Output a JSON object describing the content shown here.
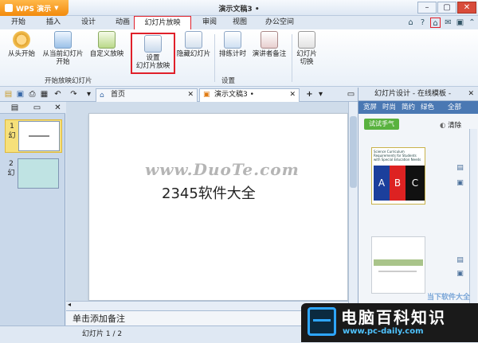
{
  "app": {
    "name": "WPS 演示",
    "doc_title": "演示文稿3 •"
  },
  "menu": {
    "tabs": [
      "开始",
      "插入",
      "设计",
      "动画",
      "幻灯片放映",
      "审阅",
      "视图",
      "办公空间"
    ],
    "active_tab": "幻灯片放映"
  },
  "ribbon": {
    "buttons": [
      "从头开始",
      "从当前幻灯片开始",
      "自定义放映",
      "设置幻灯片放映",
      "隐藏幻灯片",
      "排练计时",
      "演讲者备注",
      "幻灯片切换"
    ],
    "button_lines": {
      "b2": [
        "从当前幻灯片",
        "开始"
      ],
      "b4": [
        "设置",
        "幻灯片放映"
      ],
      "b8": [
        "幻灯片",
        "切换"
      ]
    },
    "highlighted_button": "设置幻灯片放映",
    "groups": [
      "开始放映幻灯片",
      "设置"
    ]
  },
  "doc_tabs": [
    {
      "label": "首页"
    },
    {
      "label": "演示文稿3 •"
    }
  ],
  "left_panel": {
    "slides": [
      {
        "number": "1"
      },
      {
        "number": "2"
      }
    ],
    "slide_labels": [
      "幻",
      "幻"
    ]
  },
  "slide": {
    "text": "2345软件大全",
    "watermark": "www.DuoTe.com"
  },
  "notes": {
    "placeholder": "单击添加备注"
  },
  "status": {
    "text": "幻灯片 1 / 2"
  },
  "right_panel": {
    "title": "幻灯片设计 - 在线模板 -",
    "categories": [
      "宽屏",
      "时尚",
      "简约",
      "绿色"
    ],
    "all_label": "全部",
    "try_button": "试试手气",
    "clear_button": "清除",
    "template1": {
      "title": "Science Curriculum Requirements for Students with Special Education Needs",
      "letters": [
        "A",
        "B",
        "C"
      ]
    }
  },
  "overlay": {
    "brand_title": "电脑百科知识",
    "brand_url": "www.pc-daily.com",
    "watermark2": "当下软件大全"
  },
  "colors": {
    "accent_red": "#e0202a",
    "app_orange": "#f28a0c",
    "panel_blue": "#4a78b3",
    "try_green": "#59b23f"
  }
}
